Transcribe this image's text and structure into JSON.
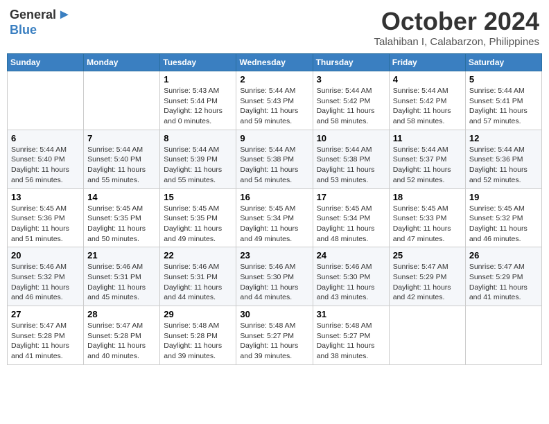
{
  "header": {
    "logo_general": "General",
    "logo_blue": "Blue",
    "month_title": "October 2024",
    "location": "Talahiban I, Calabarzon, Philippines"
  },
  "days_of_week": [
    "Sunday",
    "Monday",
    "Tuesday",
    "Wednesday",
    "Thursday",
    "Friday",
    "Saturday"
  ],
  "weeks": [
    [
      {
        "day": "",
        "info": ""
      },
      {
        "day": "",
        "info": ""
      },
      {
        "day": "1",
        "info": "Sunrise: 5:43 AM\nSunset: 5:44 PM\nDaylight: 12 hours and 0 minutes."
      },
      {
        "day": "2",
        "info": "Sunrise: 5:44 AM\nSunset: 5:43 PM\nDaylight: 11 hours and 59 minutes."
      },
      {
        "day": "3",
        "info": "Sunrise: 5:44 AM\nSunset: 5:42 PM\nDaylight: 11 hours and 58 minutes."
      },
      {
        "day": "4",
        "info": "Sunrise: 5:44 AM\nSunset: 5:42 PM\nDaylight: 11 hours and 58 minutes."
      },
      {
        "day": "5",
        "info": "Sunrise: 5:44 AM\nSunset: 5:41 PM\nDaylight: 11 hours and 57 minutes."
      }
    ],
    [
      {
        "day": "6",
        "info": "Sunrise: 5:44 AM\nSunset: 5:40 PM\nDaylight: 11 hours and 56 minutes."
      },
      {
        "day": "7",
        "info": "Sunrise: 5:44 AM\nSunset: 5:40 PM\nDaylight: 11 hours and 55 minutes."
      },
      {
        "day": "8",
        "info": "Sunrise: 5:44 AM\nSunset: 5:39 PM\nDaylight: 11 hours and 55 minutes."
      },
      {
        "day": "9",
        "info": "Sunrise: 5:44 AM\nSunset: 5:38 PM\nDaylight: 11 hours and 54 minutes."
      },
      {
        "day": "10",
        "info": "Sunrise: 5:44 AM\nSunset: 5:38 PM\nDaylight: 11 hours and 53 minutes."
      },
      {
        "day": "11",
        "info": "Sunrise: 5:44 AM\nSunset: 5:37 PM\nDaylight: 11 hours and 52 minutes."
      },
      {
        "day": "12",
        "info": "Sunrise: 5:44 AM\nSunset: 5:36 PM\nDaylight: 11 hours and 52 minutes."
      }
    ],
    [
      {
        "day": "13",
        "info": "Sunrise: 5:45 AM\nSunset: 5:36 PM\nDaylight: 11 hours and 51 minutes."
      },
      {
        "day": "14",
        "info": "Sunrise: 5:45 AM\nSunset: 5:35 PM\nDaylight: 11 hours and 50 minutes."
      },
      {
        "day": "15",
        "info": "Sunrise: 5:45 AM\nSunset: 5:35 PM\nDaylight: 11 hours and 49 minutes."
      },
      {
        "day": "16",
        "info": "Sunrise: 5:45 AM\nSunset: 5:34 PM\nDaylight: 11 hours and 49 minutes."
      },
      {
        "day": "17",
        "info": "Sunrise: 5:45 AM\nSunset: 5:34 PM\nDaylight: 11 hours and 48 minutes."
      },
      {
        "day": "18",
        "info": "Sunrise: 5:45 AM\nSunset: 5:33 PM\nDaylight: 11 hours and 47 minutes."
      },
      {
        "day": "19",
        "info": "Sunrise: 5:45 AM\nSunset: 5:32 PM\nDaylight: 11 hours and 46 minutes."
      }
    ],
    [
      {
        "day": "20",
        "info": "Sunrise: 5:46 AM\nSunset: 5:32 PM\nDaylight: 11 hours and 46 minutes."
      },
      {
        "day": "21",
        "info": "Sunrise: 5:46 AM\nSunset: 5:31 PM\nDaylight: 11 hours and 45 minutes."
      },
      {
        "day": "22",
        "info": "Sunrise: 5:46 AM\nSunset: 5:31 PM\nDaylight: 11 hours and 44 minutes."
      },
      {
        "day": "23",
        "info": "Sunrise: 5:46 AM\nSunset: 5:30 PM\nDaylight: 11 hours and 44 minutes."
      },
      {
        "day": "24",
        "info": "Sunrise: 5:46 AM\nSunset: 5:30 PM\nDaylight: 11 hours and 43 minutes."
      },
      {
        "day": "25",
        "info": "Sunrise: 5:47 AM\nSunset: 5:29 PM\nDaylight: 11 hours and 42 minutes."
      },
      {
        "day": "26",
        "info": "Sunrise: 5:47 AM\nSunset: 5:29 PM\nDaylight: 11 hours and 41 minutes."
      }
    ],
    [
      {
        "day": "27",
        "info": "Sunrise: 5:47 AM\nSunset: 5:28 PM\nDaylight: 11 hours and 41 minutes."
      },
      {
        "day": "28",
        "info": "Sunrise: 5:47 AM\nSunset: 5:28 PM\nDaylight: 11 hours and 40 minutes."
      },
      {
        "day": "29",
        "info": "Sunrise: 5:48 AM\nSunset: 5:28 PM\nDaylight: 11 hours and 39 minutes."
      },
      {
        "day": "30",
        "info": "Sunrise: 5:48 AM\nSunset: 5:27 PM\nDaylight: 11 hours and 39 minutes."
      },
      {
        "day": "31",
        "info": "Sunrise: 5:48 AM\nSunset: 5:27 PM\nDaylight: 11 hours and 38 minutes."
      },
      {
        "day": "",
        "info": ""
      },
      {
        "day": "",
        "info": ""
      }
    ]
  ]
}
